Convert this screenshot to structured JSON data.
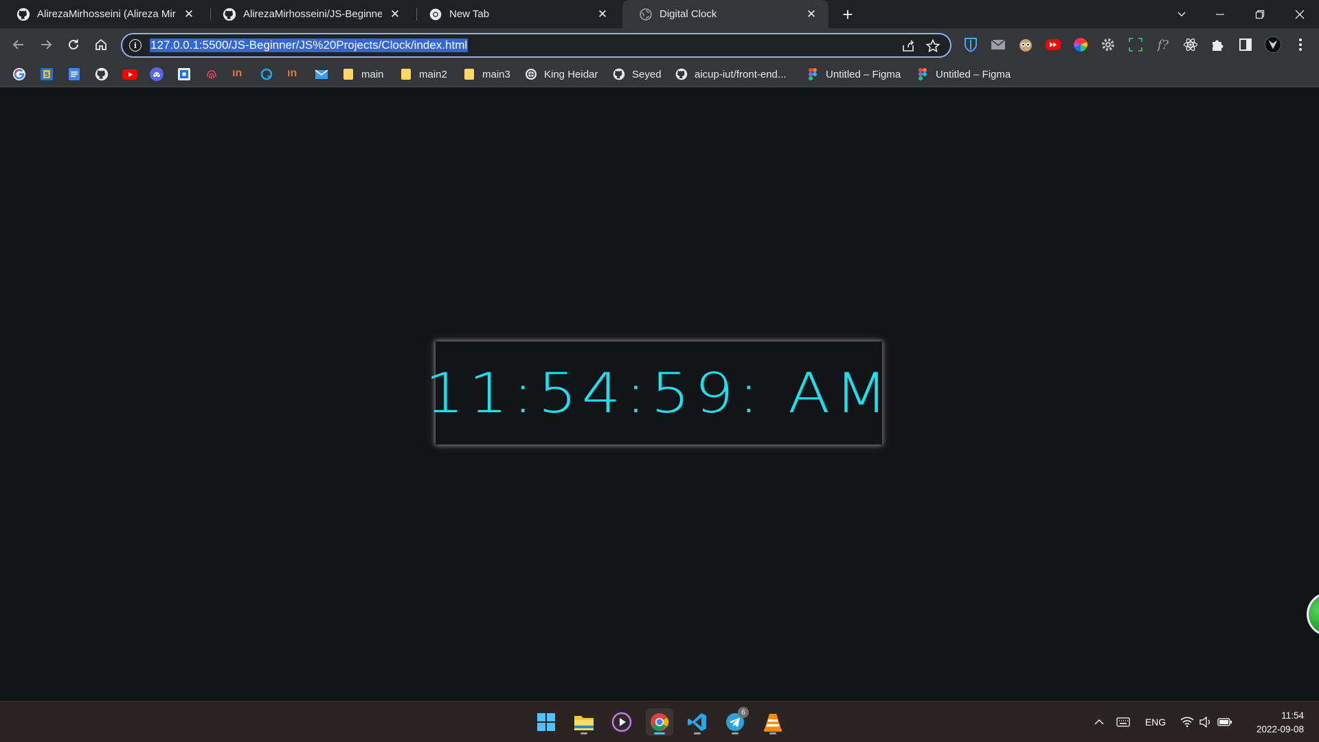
{
  "tabs": [
    {
      "title": "AlirezaMirhosseini (Alireza Mirhosseini)",
      "favicon": "github-icon",
      "active": false
    },
    {
      "title": "AlirezaMirhosseini/JS-Beginner: simple",
      "favicon": "github-icon",
      "active": false
    },
    {
      "title": "New Tab",
      "favicon": "chrome-icon",
      "active": false
    },
    {
      "title": "Digital Clock",
      "favicon": "globe-icon",
      "active": true
    }
  ],
  "toolbar": {
    "url": "127.0.0.1:5500/JS-Beginner/JS%20Projects/Clock/index.html"
  },
  "bookmarks": {
    "icon_only": [
      "google-icon",
      "google-sheets-icon",
      "google-docs-icon",
      "github-icon",
      "youtube-icon",
      "discord-icon",
      "app-icon",
      "fingerprint-icon",
      "in-icon",
      "q-icon",
      "in-icon",
      "mail-icon"
    ],
    "items": [
      {
        "label": "main",
        "icon": "folder-icon"
      },
      {
        "label": "main2",
        "icon": "folder-icon"
      },
      {
        "label": "main3",
        "icon": "folder-icon"
      },
      {
        "label": "King Heidar",
        "icon": "web-icon"
      },
      {
        "label": "Seyed",
        "icon": "github-icon"
      },
      {
        "label": "aicup-iut/front-end...",
        "icon": "github-icon"
      },
      {
        "label": "Untitled – Figma",
        "icon": "figma-icon"
      },
      {
        "label": "Untitled – Figma",
        "icon": "figma-icon"
      }
    ]
  },
  "page": {
    "clock_text": "11:54:59: AM",
    "clock_color": "#17e3f0",
    "background_color": "#131418"
  },
  "taskbar": {
    "apps": [
      "windows-start-icon",
      "file-explorer-icon",
      "media-player-icon",
      "chrome-icon",
      "vscode-icon",
      "telegram-icon",
      "vlc-icon"
    ],
    "telegram_badge": "6",
    "language": "ENG",
    "time": "11:54",
    "date": "2022-09-08"
  }
}
